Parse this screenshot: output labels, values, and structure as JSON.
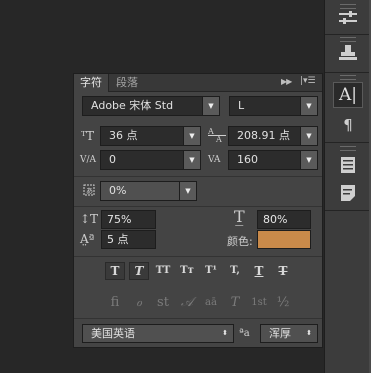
{
  "panel": {
    "tabs": [
      {
        "label": "字符",
        "active": true
      },
      {
        "label": "段落",
        "active": false
      }
    ],
    "menu_icons": {
      "collapse": "double-chevron-right-icon",
      "menu": "panel-menu-icon"
    }
  },
  "character": {
    "font_family": "Adobe 宋体 Std",
    "font_style": "L",
    "font_size": "36 点",
    "leading": "208.91 点",
    "kerning": "0",
    "tracking": "160",
    "tsume": "0%",
    "vertical_scale": "75%",
    "horizontal_scale": "80%",
    "baseline_shift": "5 点",
    "color_label": "颜色:",
    "color_value": "#c98a4a",
    "language": "美国英语",
    "aa_icon_text": "ªa",
    "antialias": "浑厚"
  },
  "type_style_buttons": [
    "T",
    "T",
    "TT",
    "Tт",
    "T¹",
    "T,",
    "T",
    "T"
  ],
  "opentype_buttons": [
    "fi",
    "ℴ",
    "st",
    "𝒜",
    "aā",
    "T",
    "1st",
    "½"
  ],
  "tool_strip": {
    "items": [
      "adjustments-icon",
      "stamp-icon",
      "character-panel-icon",
      "paragraph-panel-icon",
      "glyphs-icon",
      "notes-icon"
    ],
    "active_index": 2
  }
}
